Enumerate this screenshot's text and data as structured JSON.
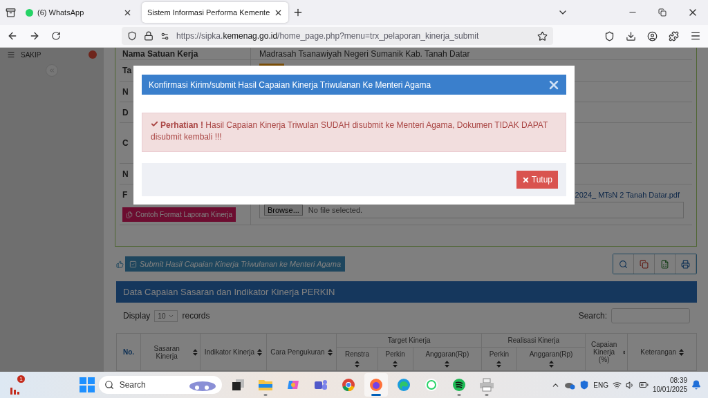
{
  "browser": {
    "tabs": [
      {
        "label": "(6) WhatsApp",
        "kind": "whatsapp",
        "selected": false
      },
      {
        "label": "Sistem Informasi Performa Kemente",
        "kind": "page",
        "selected": true
      }
    ],
    "url": {
      "prefix": "https://sipka.",
      "domain": "kemenag.go.id",
      "path": "/home_page.php?menu=trx_pelaporan_kinerja_submit"
    }
  },
  "sidebar": {
    "items": [
      {
        "label": "SAKIP"
      }
    ]
  },
  "form": {
    "rows": [
      {
        "label": "Nama Satuan Kerja",
        "kind": "text",
        "value": "Madrasah Tsanawiyah Negeri Sumanik Kab. Tanah Datar"
      },
      {
        "label": "Ta",
        "kind": "badge"
      },
      {
        "label": "N",
        "kind": "text"
      },
      {
        "label": "D",
        "kind": "text"
      },
      {
        "label": "C",
        "kind": "tall"
      },
      {
        "label": "N",
        "kind": "text"
      },
      {
        "label": "F",
        "kind": "file",
        "file_link": "2024_ MTsN 2 Tanah Datar.pdf",
        "browse": "Browse...",
        "no_file": "No file selected.",
        "template_button": "Contoh Format Laporan Kinerja"
      }
    ]
  },
  "submit_button": "Submit Hasil Capaian Kinerja Triwulanan ke Menteri Agama",
  "table_panel": {
    "title": "Data Capaian Sasaran dan Indikator Kinerja PERKIN",
    "display_label": "Display",
    "page_size": "10",
    "records_label": "records",
    "search_label": "Search:",
    "columns": [
      {
        "label": "No.",
        "sortable": false
      },
      {
        "label": "Sasaran Kinerja",
        "sortable": true
      },
      {
        "label": "Indikator Kinerja",
        "sortable": true
      },
      {
        "label": "Cara Pengukuran",
        "sortable": true
      },
      {
        "label": "Target Kinerja",
        "sortable": false,
        "children": [
          {
            "label": "Renstra",
            "sortable": true
          },
          {
            "label": "Perkin",
            "sortable": true
          },
          {
            "label": "Anggaran(Rp)",
            "sortable": true
          }
        ]
      },
      {
        "label": "Realisasi Kinerja",
        "sortable": false,
        "children": [
          {
            "label": "Perkin",
            "sortable": true
          },
          {
            "label": "Anggaran(Rp)",
            "sortable": true
          }
        ]
      },
      {
        "label": "Capaian Kinerja (%)",
        "sortable": true
      },
      {
        "label": "Keterangan",
        "sortable": true
      }
    ]
  },
  "modal": {
    "title": "Konfirmasi Kirim/submit Hasil Capaian Kinerja Triwulanan Ke Menteri Agama",
    "alert": "**Perhatian !** Hasil Capaian Kinerja Triwulan SUDAH disubmit ke Menteri Agama, Dokumen TIDAK DAPAT disubmit kembali !!!",
    "close_button": "Tutup"
  },
  "taskbar": {
    "badge": "1",
    "search_placeholder": "Search",
    "apps": [
      {
        "kind": "taskview",
        "running": false,
        "active": false
      },
      {
        "kind": "explorer",
        "running": true,
        "active": false
      },
      {
        "kind": "copilot",
        "running": false,
        "active": false
      },
      {
        "kind": "teams",
        "running": false,
        "active": false
      },
      {
        "kind": "chrome",
        "running": false,
        "active": false
      },
      {
        "kind": "firefox",
        "running": true,
        "active": true
      },
      {
        "kind": "edge",
        "running": false,
        "active": false
      },
      {
        "kind": "whatsapp",
        "running": false,
        "active": false
      },
      {
        "kind": "spotify",
        "running": true,
        "active": false
      },
      {
        "kind": "printer",
        "running": true,
        "active": false
      }
    ],
    "language": "ENG",
    "time": "08:39",
    "date": "10/01/2025"
  }
}
